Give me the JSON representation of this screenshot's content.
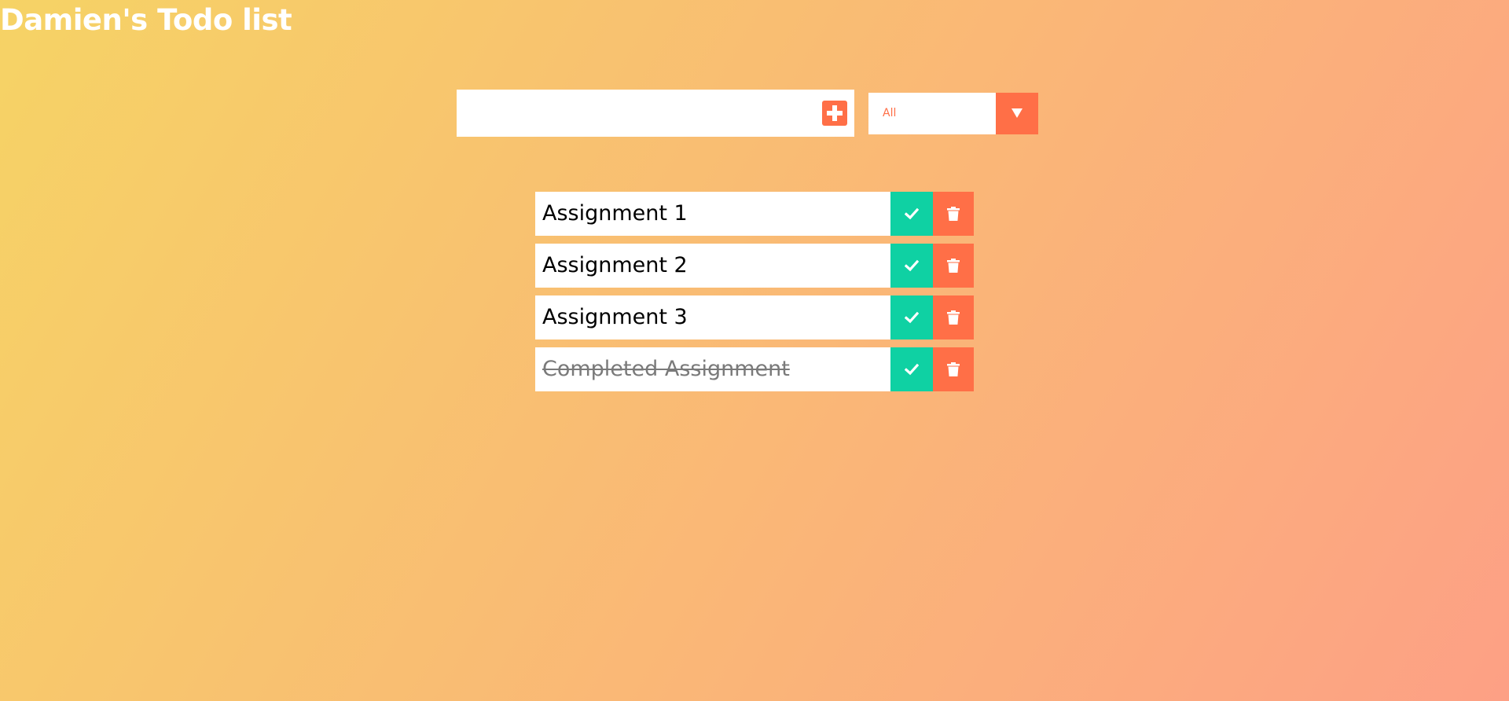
{
  "header": {
    "title": "Damien's Todo list"
  },
  "form": {
    "input_value": "",
    "input_placeholder": "",
    "add_icon": "plus-square-icon",
    "filter_selected": "All",
    "filter_arrow_icon": "caret-down-icon"
  },
  "todos": [
    {
      "text": "Assignment 1",
      "completed": false
    },
    {
      "text": "Assignment 2",
      "completed": false
    },
    {
      "text": "Assignment 3",
      "completed": false
    },
    {
      "text": "Completed Assignment",
      "completed": true
    }
  ],
  "icons": {
    "complete": "check-icon",
    "delete": "trash-icon"
  },
  "colors": {
    "gradient_start": "#f6d365",
    "gradient_end": "#fda085",
    "accent": "#ff6f47",
    "complete": "#0fd1a3"
  }
}
